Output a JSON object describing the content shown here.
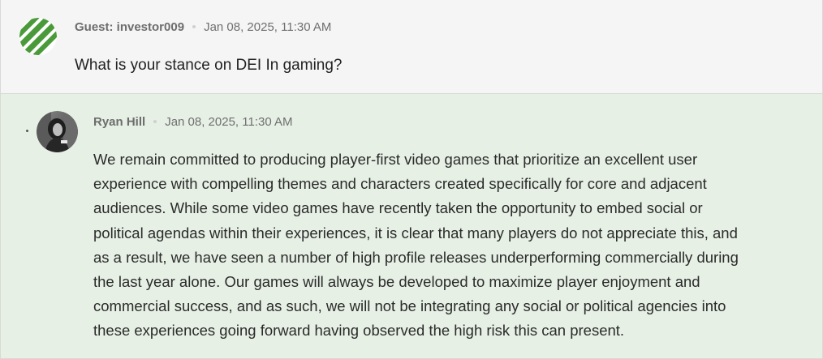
{
  "question": {
    "author": "Guest: investor009",
    "timestamp": "Jan 08, 2025, 11:30 AM",
    "text": "What is your stance on DEI In gaming?",
    "avatar_icon": "green-striped-globe-logo"
  },
  "answer": {
    "author": "Ryan Hill",
    "timestamp": "Jan 08, 2025, 11:30 AM",
    "avatar_icon": "user-photo",
    "lines": [
      "We remain committed to producing player-first video games that prioritize an excellent user",
      "experience with compelling themes and characters created specifically for core and adjacent",
      "audiences. While some video games have recently taken the opportunity to embed social or",
      "political agendas within their experiences, it is clear that many players do not appreciate this, and",
      "as a result, we have seen a number of high profile releases underperforming commercially during",
      "the last year alone. Our games will always be developed to maximize player enjoyment and",
      "commercial success, and as such, we will not be integrating any social or political agencies into",
      "these experiences going forward having observed the high risk this can present."
    ]
  },
  "colors": {
    "question_bg": "#f5f5f5",
    "answer_bg": "#e6f0e4",
    "logo_green": "#4a9a3a"
  }
}
